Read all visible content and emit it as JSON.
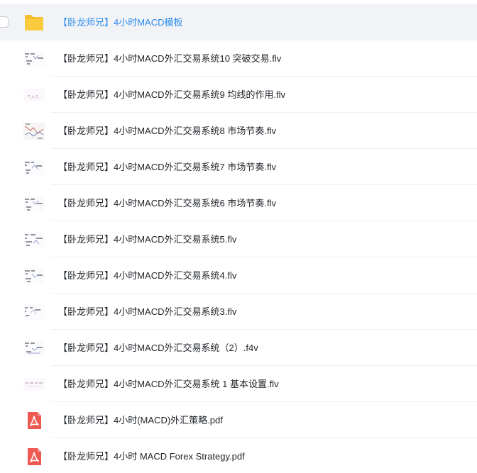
{
  "files": [
    {
      "name": "【卧龙师兄】4小时MACD模板",
      "type": "folder",
      "icon": "folder-icon",
      "selected": true
    },
    {
      "name": "【卧龙师兄】4小时MACD外汇交易系统10 突破交易.flv",
      "type": "video",
      "icon": "video-thumbnail-icon"
    },
    {
      "name": "【卧龙师兄】4小时MACD外汇交易系统9 均线的作用.flv",
      "type": "video",
      "icon": "video-thumbnail-icon"
    },
    {
      "name": "【卧龙师兄】4小时MACD外汇交易系统8 市场节奏.flv",
      "type": "video",
      "icon": "video-thumbnail-icon"
    },
    {
      "name": "【卧龙师兄】4小时MACD外汇交易系统7 市场节奏.flv",
      "type": "video",
      "icon": "video-thumbnail-icon"
    },
    {
      "name": "【卧龙师兄】4小时MACD外汇交易系统6 市场节奏.flv",
      "type": "video",
      "icon": "video-thumbnail-icon"
    },
    {
      "name": "【卧龙师兄】4小时MACD外汇交易系统5.flv",
      "type": "video",
      "icon": "video-thumbnail-icon"
    },
    {
      "name": "【卧龙师兄】4小时MACD外汇交易系统4.flv",
      "type": "video",
      "icon": "video-thumbnail-icon"
    },
    {
      "name": "【卧龙师兄】4小时MACD外汇交易系统3.flv",
      "type": "video",
      "icon": "video-thumbnail-icon"
    },
    {
      "name": "【卧龙师兄】4小时MACD外汇交易系统（2）.f4v",
      "type": "video",
      "icon": "video-thumbnail-icon"
    },
    {
      "name": "【卧龙师兄】4小时MACD外汇交易系统 1 基本设置.flv",
      "type": "video",
      "icon": "video-thumbnail-icon"
    },
    {
      "name": "【卧龙师兄】4小时(MACD)外汇策略.pdf",
      "type": "pdf",
      "icon": "pdf-icon"
    },
    {
      "name": "【卧龙师兄】4小时 MACD Forex Strategy.pdf",
      "type": "pdf",
      "icon": "pdf-icon"
    }
  ],
  "colors": {
    "selected_row_bg": "#f1f3f7",
    "selected_text": "#2a8ceb",
    "text": "#1f2328",
    "folder": "#f5bd2f",
    "pdf": "#ee5a52"
  }
}
